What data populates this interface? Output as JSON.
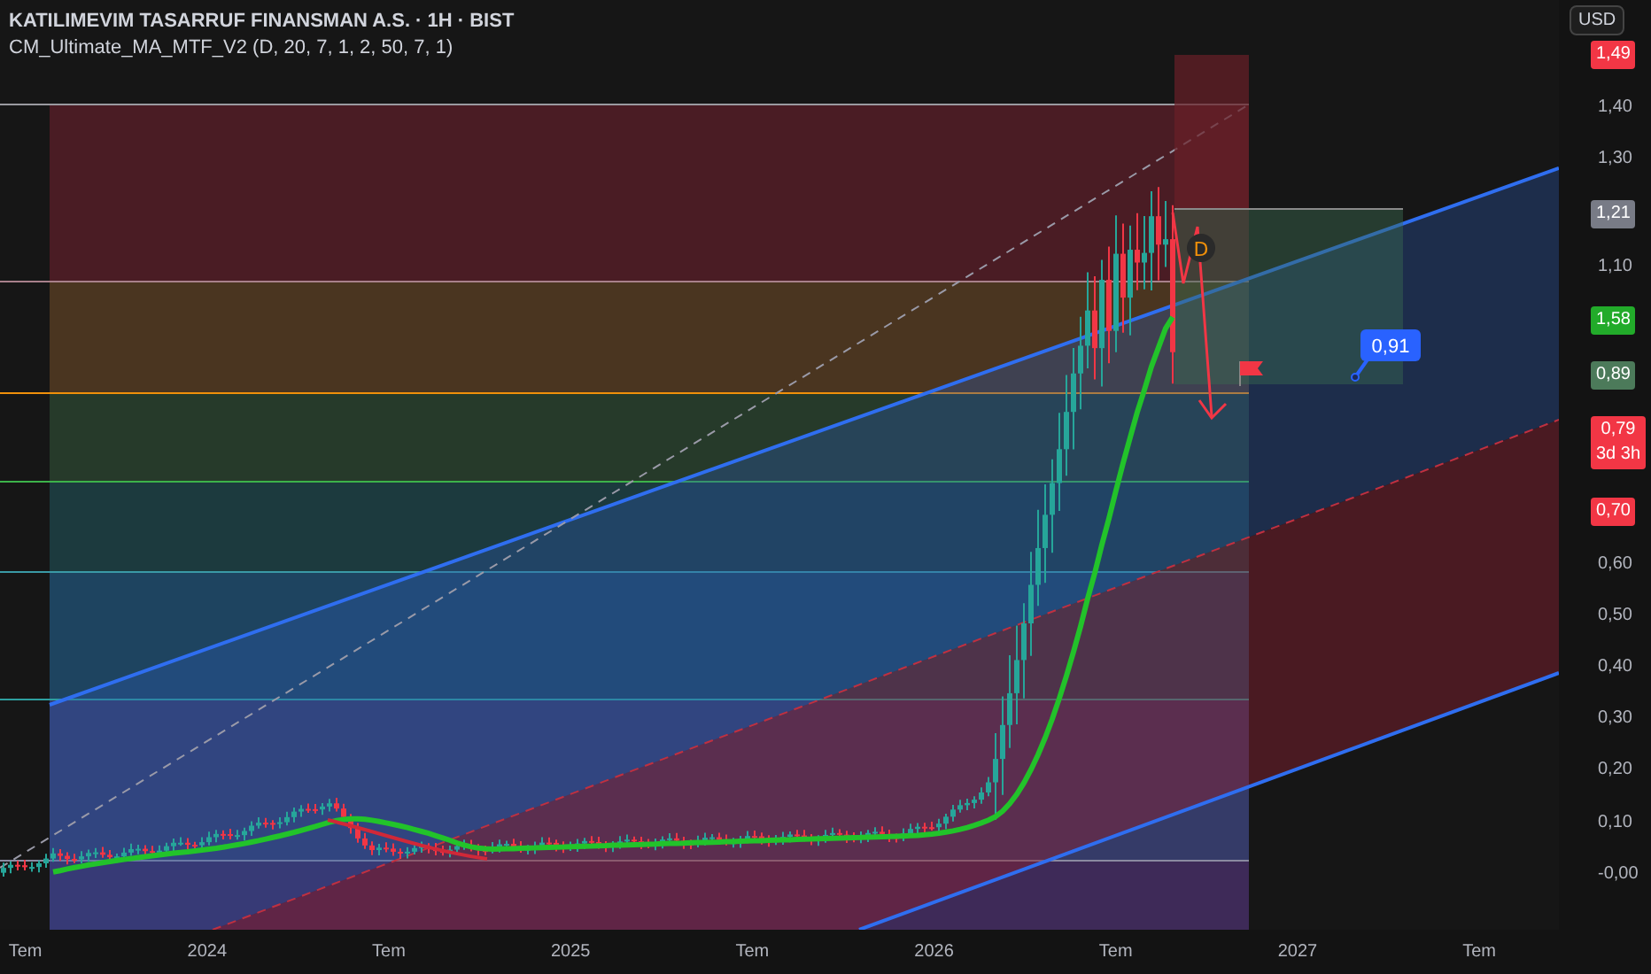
{
  "header": {
    "symbol": "KATILIMEVIM TASARRUF FINANSMAN A.S. · 1H · BIST",
    "indicator": "CM_Ultimate_MA_MTF_V2 (D, 20, 7, 1, 2, 50, 7, 1)"
  },
  "chart": {
    "pattern_label": "D",
    "callout": "0,91"
  },
  "price_axis": {
    "currency_button": "USD",
    "labels": [
      {
        "kind": "badge",
        "text": "1,49",
        "color": "#f23645"
      },
      {
        "kind": "tick",
        "text": "1,40"
      },
      {
        "kind": "tick",
        "text": "1,30"
      },
      {
        "kind": "badge",
        "text": "1,21",
        "color": "#787b86"
      },
      {
        "kind": "tick",
        "text": "1,10"
      },
      {
        "kind": "badge",
        "text": "1,58",
        "color": "#22ab2a"
      },
      {
        "kind": "badge",
        "text": "0,89",
        "color": "#4c7a5a"
      },
      {
        "kind": "badge",
        "text": "0,79",
        "countdown": "3d 3h",
        "color": "#f23645"
      },
      {
        "kind": "badge",
        "text": "0,70",
        "color": "#f23645"
      },
      {
        "kind": "tick",
        "text": "0,60"
      },
      {
        "kind": "tick",
        "text": "0,50"
      },
      {
        "kind": "tick",
        "text": "0,40"
      },
      {
        "kind": "tick",
        "text": "0,30"
      },
      {
        "kind": "tick",
        "text": "0,20"
      },
      {
        "kind": "tick",
        "text": "0,10"
      },
      {
        "kind": "tick",
        "text": "-0,00"
      }
    ]
  },
  "time_axis": [
    "Tem",
    "2024",
    "Tem",
    "2025",
    "Tem",
    "2026",
    "Tem",
    "2027",
    "Tem"
  ]
}
